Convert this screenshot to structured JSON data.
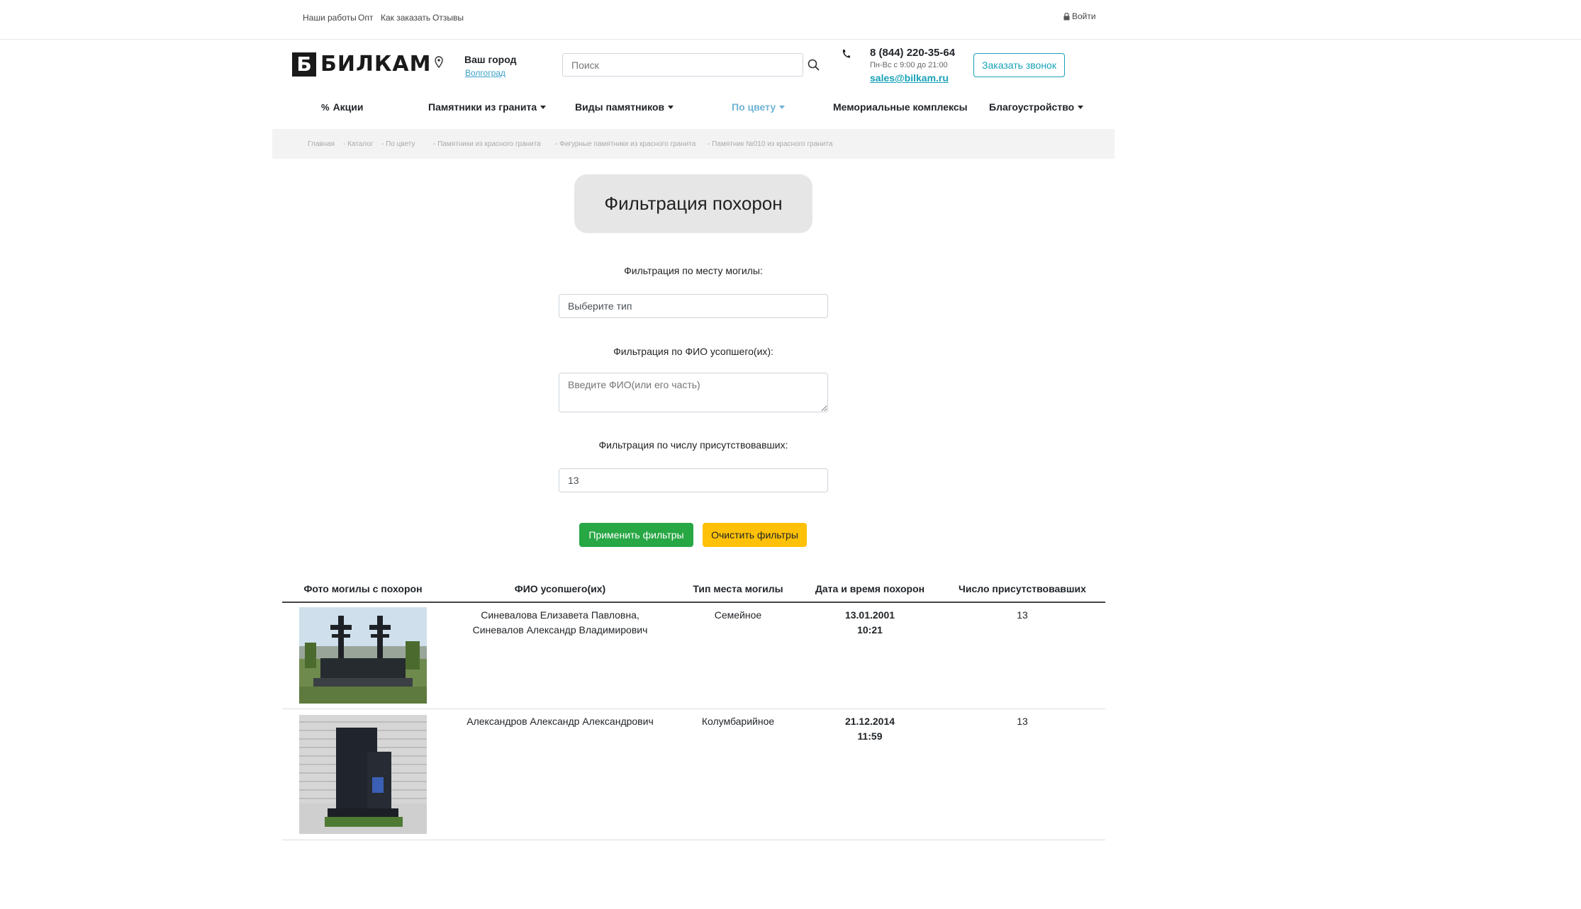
{
  "topbar": {
    "links": [
      "Наши работы",
      "Опт",
      "Как заказать",
      "Отзывы"
    ],
    "login": "Войти"
  },
  "header": {
    "logo_letter": "Б",
    "logo_text": "БИЛКАМ",
    "city_label": "Ваш город",
    "city_value": "Волгоград",
    "search_placeholder": "Поиск",
    "phone": "8 (844) 220-35-64",
    "hours": "Пн-Вс с 9:00 до 21:00",
    "email": "sales@bilkam.ru",
    "callback_button": "Заказать звонок"
  },
  "nav": {
    "items": [
      {
        "label": "Акции"
      },
      {
        "label": "Памятники из гранита"
      },
      {
        "label": "Виды памятников"
      },
      {
        "label": "По цвету"
      },
      {
        "label": "Мемориальные комплексы"
      },
      {
        "label": "Благоустройство"
      }
    ]
  },
  "breadcrumb": [
    "Главная",
    "- Каталог",
    "- По цвету",
    "- Памятники из красного гранита",
    "- Фигурные памятники из красного гранита",
    "- Памятник №010 из красного гранита"
  ],
  "filter": {
    "title": "Фильтрация похорон",
    "place_label": "Фильтрация по месту могилы:",
    "place_value": "Выберите тип",
    "name_label": "Фильтрация по ФИО усопшего(их):",
    "name_placeholder": "Введите ФИО(или его часть)",
    "count_label": "Фильтрация по числу присутствовавших:",
    "count_value": "13",
    "apply_button": "Применить фильтры",
    "clear_button": "Очистить фильтры"
  },
  "table": {
    "headers": [
      "Фото могилы с похорон",
      "ФИО усопшего(их)",
      "Тип места могилы",
      "Дата и время похорон",
      "Число присутствовавших"
    ],
    "rows": [
      {
        "name_line1": "Синевалова Елизавета Павловна,",
        "name_line2": "Синевалов Александр Владимирович",
        "type": "Семейное",
        "date": "13.01.2001",
        "time": "10:21",
        "count": "13"
      },
      {
        "name_line1": "Александров Александр Александрович",
        "name_line2": "",
        "type": "Колумбарийное",
        "date": "21.12.2014",
        "time": "11:59",
        "count": "13"
      }
    ]
  },
  "colors": {
    "accent": "#17a2b8",
    "apply": "#28a745",
    "clear": "#ffc107",
    "nav_active": "#6fb3d6"
  }
}
